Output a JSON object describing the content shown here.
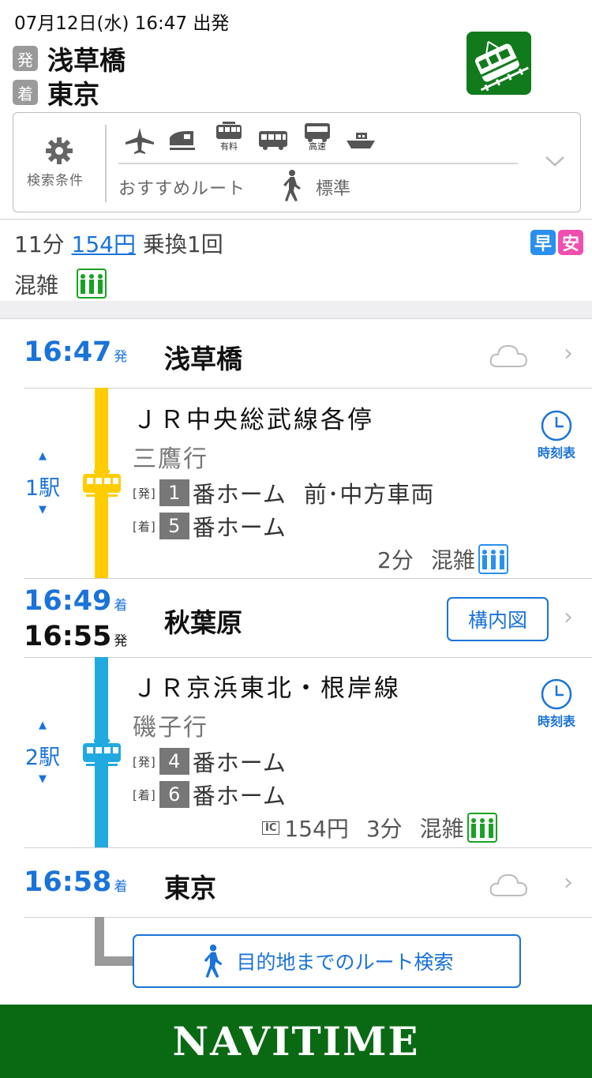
{
  "header": {
    "departure": "07月12日(水) 16:47 出発",
    "from_badge": "発",
    "from_station": "浅草橋",
    "to_badge": "着",
    "to_station": "東京"
  },
  "conditions": {
    "label": "検索条件",
    "modes": [
      {
        "icon": "airplane-icon",
        "caption": ""
      },
      {
        "icon": "shinkansen-icon",
        "caption": ""
      },
      {
        "icon": "limited-express-icon",
        "caption": "有料"
      },
      {
        "icon": "bus-icon",
        "caption": ""
      },
      {
        "icon": "highway-bus-icon",
        "caption": "高速"
      },
      {
        "icon": "ferry-icon",
        "caption": ""
      }
    ],
    "route_type": "おすすめルート",
    "walk_speed": "標準"
  },
  "summary": {
    "duration": "11分",
    "fare": "154円",
    "transfers": "乗換1回",
    "congestion_label": "混雑",
    "badge_fast": "早",
    "badge_cheap": "安"
  },
  "route": {
    "start": {
      "time": "16:47",
      "suffix": "発",
      "station": "浅草橋"
    },
    "leg1": {
      "line": "ＪＲ中央総武線各停",
      "bound": "三鷹行",
      "stops": "1駅",
      "dep_tag": "[発]",
      "dep_platform": "1",
      "dep_text": "番ホーム",
      "dep_note": "前･中方車両",
      "arr_tag": "[着]",
      "arr_platform": "5",
      "arr_text": "番ホーム",
      "duration": "2分",
      "congestion": "混雑",
      "timetable": "時刻表",
      "color": "#ffcc00"
    },
    "transfer": {
      "arr_time": "16:49",
      "arr_suffix": "着",
      "dep_time": "16:55",
      "dep_suffix": "発",
      "station": "秋葉原",
      "map_button": "構内図"
    },
    "leg2": {
      "line": "ＪＲ京浜東北・根岸線",
      "bound": "磯子行",
      "stops": "2駅",
      "dep_tag": "[発]",
      "dep_platform": "4",
      "dep_text": "番ホーム",
      "arr_tag": "[着]",
      "arr_platform": "6",
      "arr_text": "番ホーム",
      "ic_label": "IC",
      "fare": "154円",
      "duration": "3分",
      "congestion": "混雑",
      "timetable": "時刻表",
      "color": "#21aae0"
    },
    "end": {
      "time": "16:58",
      "suffix": "着",
      "station": "東京"
    },
    "dest_search": "目的地までのルート検索"
  },
  "footer": {
    "brand": "NAVITIME",
    "color": "#0a6a14"
  }
}
